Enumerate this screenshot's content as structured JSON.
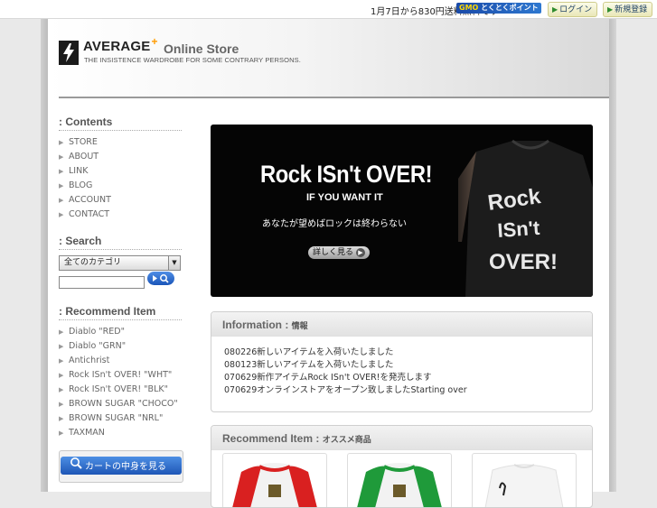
{
  "topbar": {
    "notice": "1月7日から830円送料無料です",
    "gmo_prefix": "GMO",
    "gmo_text": "とくとくポイント",
    "login_label": "ログイン",
    "register_label": "新規登録"
  },
  "header": {
    "brand": "AVERAGE",
    "brand_mark": "+",
    "store": "Online Store",
    "tagline": "THE INSISTENCE WARDROBE FOR SOME CONTRARY PERSONS."
  },
  "sidebar": {
    "contents_title": ": Contents",
    "contents": [
      "STORE",
      "ABOUT",
      "LINK",
      "BLOG",
      "ACCOUNT",
      "CONTACT"
    ],
    "search_title": ": Search",
    "search_select_value": "全てのカテゴリ",
    "search_go": "▸◦",
    "recommend_title": ": Recommend Item",
    "recommend": [
      "Diablo \"RED\"",
      "Diablo \"GRN\"",
      "Antichrist",
      "Rock ISn't OVER! \"WHT\"",
      "Rock ISn't OVER! \"BLK\"",
      "BROWN SUGAR \"CHOCO\"",
      "BROWN SUGAR \"NRL\"",
      "TAXMAN"
    ],
    "cart_label": "カートの中身を見る"
  },
  "banner": {
    "title": "Rock ISn't OVER!",
    "subtitle": "IF YOU WANT IT",
    "tagline_jp": "あなたが望めばロックは終わらない",
    "more_label": "詳しく見る"
  },
  "info": {
    "title": "Information : ",
    "title_jp": "情報",
    "items": [
      "080226新しいアイテムを入荷いたしました",
      "080123新しいアイテムを入荷いたしました",
      "070629新作アイテムRock ISn't OVER!を発売します",
      "070629オンラインストアをオープン致しましたStarting over"
    ]
  },
  "recommend_panel": {
    "title": "Recommend Item : ",
    "title_jp": "オススメ商品"
  },
  "colors": {
    "accent_orange": "#ff9b00",
    "button_blue": "#1e56b6",
    "banner_bg": "#050505"
  }
}
